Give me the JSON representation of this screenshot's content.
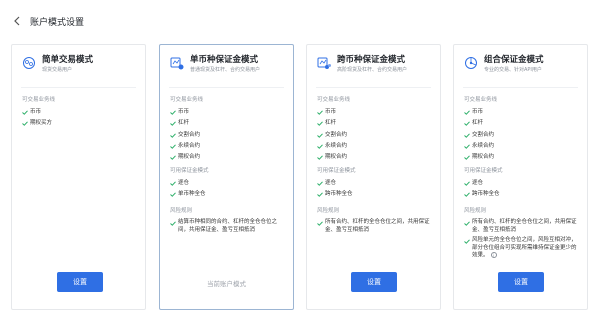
{
  "header": {
    "title": "账户模式设置"
  },
  "colors": {
    "accent": "#2f6fe4",
    "check": "#2aae67",
    "selected_border": "#9cb5d3"
  },
  "cards": [
    {
      "title": "简单交易模式",
      "desc": "现货交易用户",
      "icon": "simple-mode-icon",
      "tradable_title": "可交易业务线",
      "tradable": [
        "币币",
        "期权买方"
      ],
      "margin_title": "",
      "margin": [],
      "risk_title": "",
      "risk": [],
      "button": "设置",
      "selected": false
    },
    {
      "title": "单币种保证金模式",
      "desc": "普通现货及杠杆、合约交易用户",
      "icon": "single-currency-icon",
      "tradable_title": "可交易业务线",
      "tradable": [
        "币币",
        "杠杆",
        "交割合约",
        "永续合约",
        "期权合约"
      ],
      "margin_title": "可用保证金模式",
      "margin": [
        "逐仓",
        "单币种全仓"
      ],
      "risk_title": "风险规则",
      "risk": [
        "结算币种相同的合约、杠杆的全仓仓位之间，共用保证金、盈亏互相抵消"
      ],
      "button": "",
      "current": "当前账户模式",
      "selected": true
    },
    {
      "title": "跨币种保证金模式",
      "desc": "高阶现货及杠杆、合约交易用户",
      "icon": "cross-currency-icon",
      "tradable_title": "可交易业务线",
      "tradable": [
        "币币",
        "杠杆",
        "交割合约",
        "永续合约",
        "期权合约"
      ],
      "margin_title": "可用保证金模式",
      "margin": [
        "逐仓",
        "跨币种全仓"
      ],
      "risk_title": "风险规则",
      "risk": [
        "所有合约、杠杆的全仓仓位之间，共用保证金、盈亏互相抵消"
      ],
      "button": "设置",
      "selected": false
    },
    {
      "title": "组合保证金模式",
      "desc": "专业的交易、针对API用户",
      "icon": "portfolio-margin-icon",
      "tradable_title": "可交易业务线",
      "tradable": [
        "币币",
        "杠杆",
        "交割合约",
        "永续合约",
        "期权合约"
      ],
      "margin_title": "可用保证金模式",
      "margin": [
        "逐仓",
        "跨币种全仓"
      ],
      "risk_title": "风险规则",
      "risk": [
        "所有合约、杠杆的全仓仓位之间，共用保证金、盈亏互相抵消",
        "风险单元的全仓仓位之间，风险互相对冲，部分仓位组合可实现所需维持保证金更少的效果。"
      ],
      "button": "设置",
      "selected": false
    }
  ]
}
